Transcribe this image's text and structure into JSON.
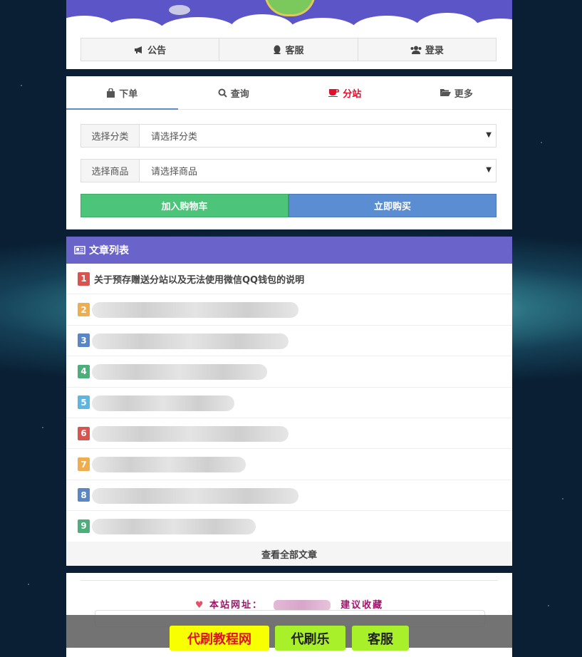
{
  "header": {
    "nav": [
      {
        "label": "公告",
        "icon": "bullhorn-icon"
      },
      {
        "label": "客服",
        "icon": "qq-icon"
      },
      {
        "label": "登录",
        "icon": "users-icon"
      }
    ]
  },
  "order": {
    "tabs": [
      {
        "label": "下单",
        "icon": "shopping-bag-icon",
        "active": true
      },
      {
        "label": "查询",
        "icon": "search-icon"
      },
      {
        "label": "分站",
        "icon": "coffee-icon",
        "color": "#e0102d"
      },
      {
        "label": "更多",
        "icon": "folder-open-icon"
      }
    ],
    "category_label": "选择分类",
    "category_value": "请选择分类",
    "product_label": "选择商品",
    "product_value": "请选择商品",
    "add_cart_label": "加入购物车",
    "buy_now_label": "立即购买",
    "colors": {
      "add_cart": "#4cc47a",
      "buy_now": "#5b8dd3"
    }
  },
  "articles": {
    "title": "文章列表",
    "items": [
      {
        "num": "1",
        "title": "关于预存赠送分站以及无法使用微信QQ钱包的说明",
        "color": "#d9534f"
      },
      {
        "num": "2",
        "title": "",
        "color": "#f0ad4e"
      },
      {
        "num": "3",
        "title": "",
        "color": "#5b86c5"
      },
      {
        "num": "4",
        "title": "",
        "color": "#4cae7a"
      },
      {
        "num": "5",
        "title": "",
        "color": "#5bb6e3"
      },
      {
        "num": "6",
        "title": "",
        "color": "#d9534f"
      },
      {
        "num": "7",
        "title": "",
        "color": "#f0ad4e"
      },
      {
        "num": "8",
        "title": "",
        "color": "#5b86c5"
      },
      {
        "num": "9",
        "title": "",
        "color": "#4cae7a"
      }
    ],
    "view_all": "查看全部文章"
  },
  "footer": {
    "site_label": "本站网址：",
    "bookmark": "建议收藏"
  },
  "bottom_bar": [
    {
      "label": "代刷教程网",
      "bg": "#f7ff00",
      "fg": "#e0102d"
    },
    {
      "label": "代刷乐",
      "bg": "#a8f02a",
      "fg": "#222"
    },
    {
      "label": "客服",
      "bg": "#a8f02a",
      "fg": "#222"
    }
  ]
}
